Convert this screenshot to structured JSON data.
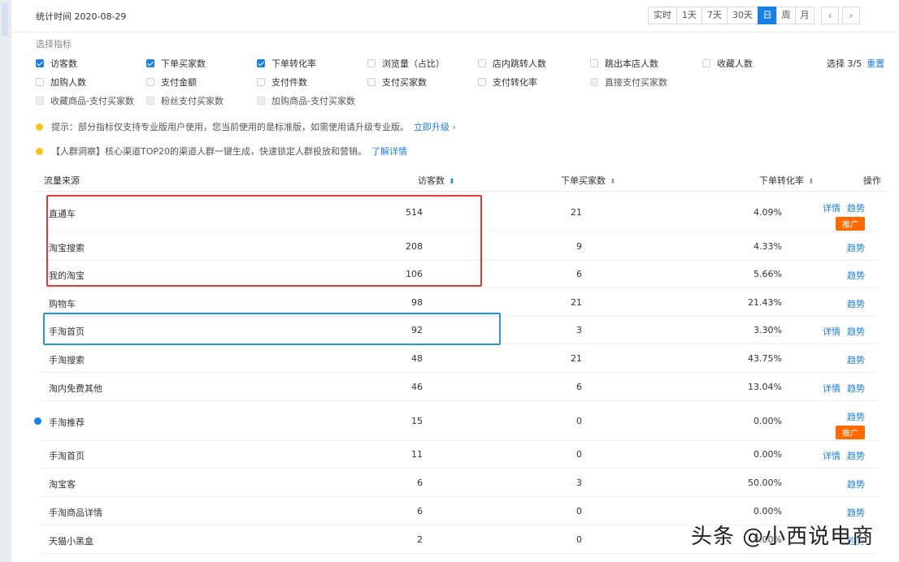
{
  "header": {
    "stat_time": "统计时间 2020-08-29",
    "segments": [
      "实时",
      "1天",
      "7天",
      "30天",
      "日",
      "周",
      "月"
    ],
    "active_segment": "日",
    "prev": "‹",
    "next": "›"
  },
  "metrics": {
    "title": "选择指标",
    "items": [
      {
        "label": "访客数",
        "state": "checked"
      },
      {
        "label": "下单买家数",
        "state": "checked"
      },
      {
        "label": "下单转化率",
        "state": "checked"
      },
      {
        "label": "浏览量（占比）",
        "state": "unchecked"
      },
      {
        "label": "店内跳转人数",
        "state": "unchecked"
      },
      {
        "label": "跳出本店人数",
        "state": "unchecked"
      },
      {
        "label": "收藏人数",
        "state": "unchecked"
      },
      {
        "label": "加购人数",
        "state": "unchecked"
      },
      {
        "label": "支付金额",
        "state": "unchecked"
      },
      {
        "label": "支付件数",
        "state": "unchecked"
      },
      {
        "label": "支付买家数",
        "state": "unchecked"
      },
      {
        "label": "支付转化率",
        "state": "unchecked"
      },
      {
        "label": "直接支付买家数",
        "state": "disabled"
      },
      {
        "label": "收藏商品-支付买家数",
        "state": "disabled"
      },
      {
        "label": "粉丝支付买家数",
        "state": "disabled"
      },
      {
        "label": "加购商品-支付买家数",
        "state": "disabled"
      }
    ],
    "selected": "选择 3/5",
    "reset": "重置"
  },
  "notices": [
    {
      "text": "提示：部分指标仅支持专业版用户使用，您当前使用的是标准版，如需使用请升级专业版。",
      "link": "立即升级 ›"
    },
    {
      "text": "【人群洞察】核心渠道TOP20的渠道人群一键生成，快速锁定人群投放和营销。",
      "link": "了解详情"
    }
  ],
  "table": {
    "columns": {
      "name": "流量来源",
      "uv": "访客数",
      "buyers": "下单买家数",
      "rate": "下单转化率",
      "action": "操作"
    },
    "rows": [
      {
        "name": "直通车",
        "uv": "514",
        "buyers": "21",
        "rate": "4.09%",
        "actions": [
          "详情",
          "趋势"
        ],
        "promo": "推广"
      },
      {
        "name": "淘宝搜索",
        "uv": "208",
        "buyers": "9",
        "rate": "4.33%",
        "actions": [
          "趋势"
        ]
      },
      {
        "name": "我的淘宝",
        "uv": "106",
        "buyers": "6",
        "rate": "5.66%",
        "actions": [
          "趋势"
        ]
      },
      {
        "name": "购物车",
        "uv": "98",
        "buyers": "21",
        "rate": "21.43%",
        "actions": [
          "趋势"
        ]
      },
      {
        "name": "手淘首页",
        "uv": "92",
        "buyers": "3",
        "rate": "3.30%",
        "actions": [
          "详情",
          "趋势"
        ]
      },
      {
        "name": "手淘搜索",
        "uv": "48",
        "buyers": "21",
        "rate": "43.75%",
        "actions": [
          "趋势"
        ]
      },
      {
        "name": "淘内免费其他",
        "uv": "46",
        "buyers": "6",
        "rate": "13.04%",
        "actions": [
          "详情",
          "趋势"
        ]
      },
      {
        "name": "手淘推荐",
        "uv": "15",
        "buyers": "0",
        "rate": "0.00%",
        "actions": [
          "趋势"
        ],
        "promo": "推广"
      },
      {
        "name": "手淘首页",
        "uv": "11",
        "buyers": "0",
        "rate": "0.00%",
        "actions": [
          "详情",
          "趋势"
        ]
      },
      {
        "name": "淘宝客",
        "uv": "6",
        "buyers": "3",
        "rate": "50.00%",
        "actions": [
          "趋势"
        ]
      },
      {
        "name": "手淘商品详情",
        "uv": "6",
        "buyers": "0",
        "rate": "0.00%",
        "actions": [
          "趋势"
        ]
      },
      {
        "name": "天猫小黑盒",
        "uv": "2",
        "buyers": "0",
        "rate": "0.00%",
        "actions": [
          "趋势"
        ]
      }
    ]
  },
  "watermark": "头条 @小西说电商",
  "colors": {
    "accent": "#1a7fe6",
    "promo": "#ff6a00",
    "highlight_red": "#e53935",
    "highlight_blue": "#1e9be3"
  }
}
